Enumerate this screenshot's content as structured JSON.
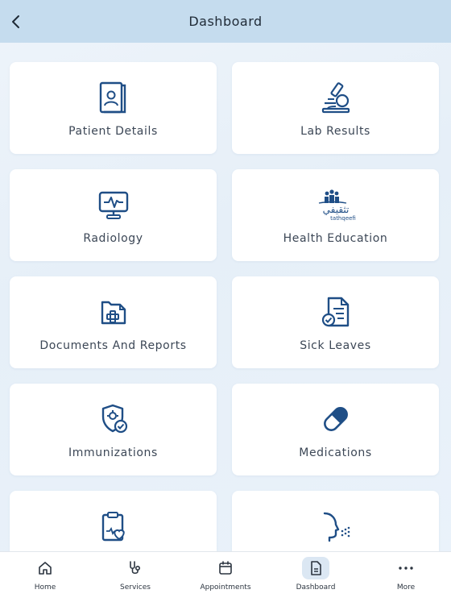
{
  "header": {
    "title": "Dashboard"
  },
  "cards": [
    {
      "label": "Patient Details"
    },
    {
      "label": "Lab Results"
    },
    {
      "label": "Radiology"
    },
    {
      "label": "Health Education"
    },
    {
      "label": "Documents And Reports"
    },
    {
      "label": "Sick Leaves"
    },
    {
      "label": "Immunizations"
    },
    {
      "label": "Medications"
    },
    {
      "label": ""
    },
    {
      "label": ""
    }
  ],
  "health_education_logo": {
    "arabic": "تثقيفي",
    "latin": "tathqeefi"
  },
  "tabs": [
    {
      "label": "Home",
      "icon": "home-icon"
    },
    {
      "label": "Services",
      "icon": "stethoscope-icon"
    },
    {
      "label": "Appointments",
      "icon": "calendar-icon"
    },
    {
      "label": "Dashboard",
      "icon": "document-icon",
      "active": true
    },
    {
      "label": "More",
      "icon": "more-icon"
    }
  ],
  "colors": {
    "accent": "#1f4e86",
    "header": "#c5dcee",
    "active_tab": "#dbe7f3"
  }
}
